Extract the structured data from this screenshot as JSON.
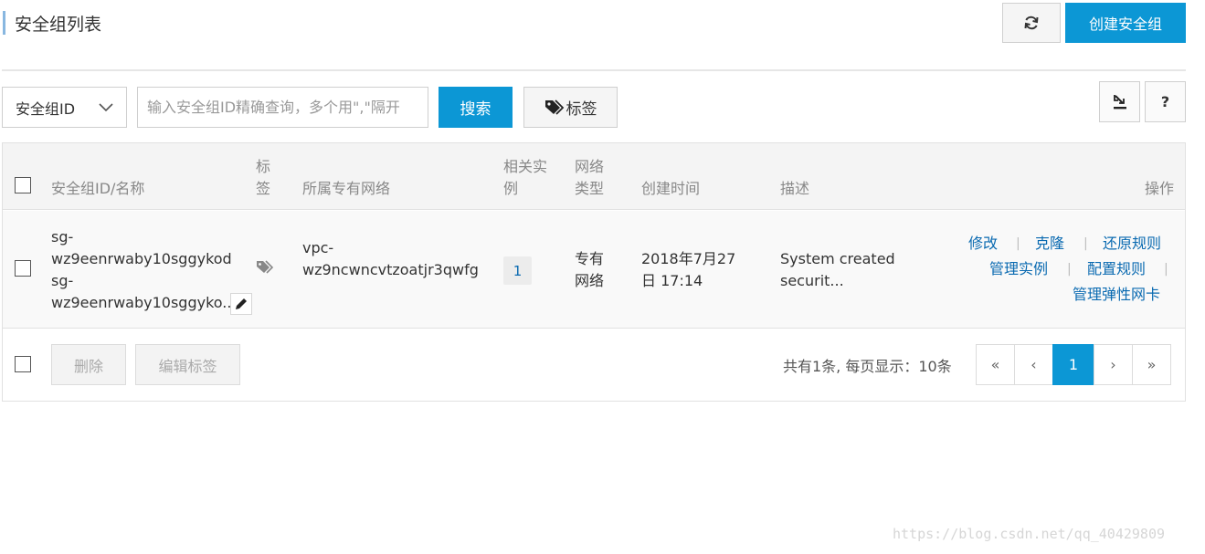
{
  "page": {
    "title": "安全组列表",
    "create_button": "创建安全组",
    "refresh_icon": "refresh-icon"
  },
  "toolbar": {
    "filter_select": "安全组ID",
    "search_placeholder": "输入安全组ID精确查询，多个用\",\"隔开",
    "search_button": "搜索",
    "tag_button": "标签",
    "help_button": "?"
  },
  "table": {
    "headers": {
      "id_name": "安全组ID/名称",
      "tags_1": "标",
      "tags_2": "签",
      "vpc": "所属专有网络",
      "instances_1": "相关实",
      "instances_2": "例",
      "network_type_1": "网络",
      "network_type_2": "类型",
      "created": "创建时间",
      "description": "描述",
      "actions": "操作"
    },
    "rows": [
      {
        "id_1": "sg-",
        "id_2": "wz9eenrwaby10sggykod",
        "name_1": "sg-",
        "name_2": "wz9eenrwaby10sggyko...",
        "vpc_1": "vpc-",
        "vpc_2": "wz9ncwncvtzoatjr3qwfg",
        "instances": "1",
        "network_type_1": "专有",
        "network_type_2": "网络",
        "created_1": "2018年7月27",
        "created_2": "日 17:14",
        "description_1": "System created",
        "description_2": "securit...",
        "actions": {
          "modify": "修改",
          "clone": "克隆",
          "restore_rules": "还原规则",
          "manage_instances": "管理实例",
          "configure_rules": "配置规则",
          "manage_eni": "管理弹性网卡"
        }
      }
    ]
  },
  "footer": {
    "delete_button": "删除",
    "edit_tags_button": "编辑标签",
    "total_text": "共有1条, 每页显示：10条",
    "pager": {
      "first": "«",
      "prev": "‹",
      "current": "1",
      "next": "›",
      "last": "»"
    }
  },
  "watermark": "https://blog.csdn.net/qq_40429809",
  "colors": {
    "primary": "#0c97d5",
    "link": "#0a6ab1",
    "title_accent": "#88b7e0"
  }
}
